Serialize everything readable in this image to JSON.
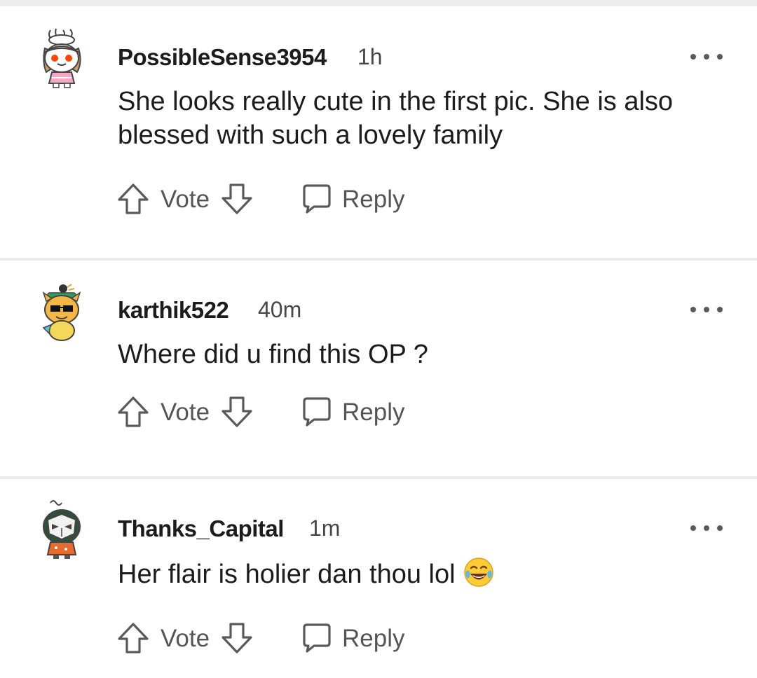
{
  "comments": [
    {
      "username": "PossibleSense3954",
      "time": "1h",
      "text": "She looks really cute in the first pic. She is also blessed with such a lovely family",
      "vote_label": "Vote",
      "reply_label": "Reply"
    },
    {
      "username": "karthik522",
      "time": "40m",
      "text": "Where did u find this OP ?",
      "vote_label": "Vote",
      "reply_label": "Reply"
    },
    {
      "username": "Thanks_Capital",
      "time": "1m",
      "text": "Her flair is holier dan thou lol",
      "emoji": "face-with-tears-of-joy-icon",
      "vote_label": "Vote",
      "reply_label": "Reply"
    }
  ],
  "icons": {
    "upvote": "upvote-arrow-icon",
    "downvote": "downvote-arrow-icon",
    "reply": "speech-bubble-icon",
    "more": "overflow-menu-icon"
  },
  "colors": {
    "background": "#ededed",
    "card": "#ffffff",
    "text": "#1c1c1c",
    "muted": "#555555"
  }
}
